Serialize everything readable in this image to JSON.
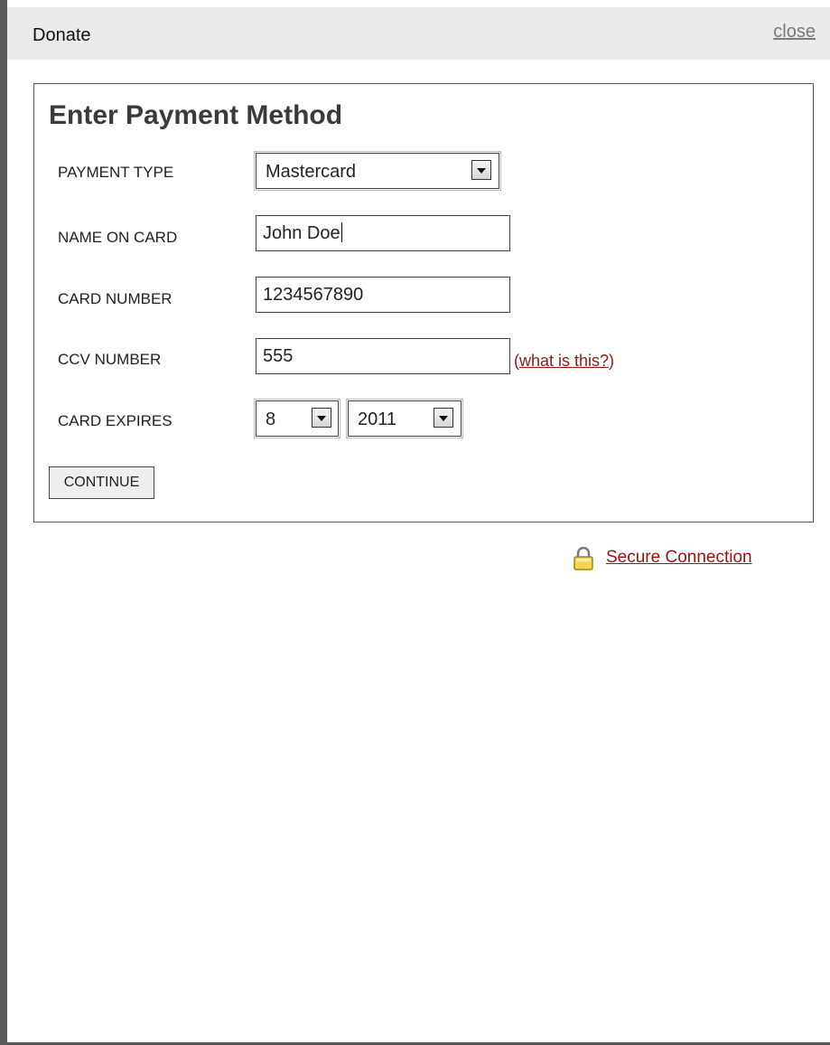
{
  "dialog": {
    "title": "Donate",
    "close_label": "close"
  },
  "form": {
    "heading": "Enter Payment Method",
    "payment_type": {
      "label": "PAYMENT TYPE",
      "selected": "Mastercard"
    },
    "name_on_card": {
      "label": "NAME ON CARD",
      "value": "John Doe"
    },
    "card_number": {
      "label": "CARD NUMBER",
      "value": "1234567890"
    },
    "ccv_number": {
      "label": "CCV NUMBER",
      "value": "555",
      "help_open": "(",
      "help_link": "what is this?",
      "help_close": ")"
    },
    "card_expires": {
      "label": "CARD EXPIRES",
      "month": "8",
      "year": "2011"
    },
    "continue_label": "CONTINUE"
  },
  "footer": {
    "secure_label": "Secure Connection",
    "secure_icon": "lock-icon"
  },
  "colors": {
    "link_red": "#9b1010",
    "titlebar_bg": "#ebebeb",
    "border_dark": "#5a5a5a"
  }
}
